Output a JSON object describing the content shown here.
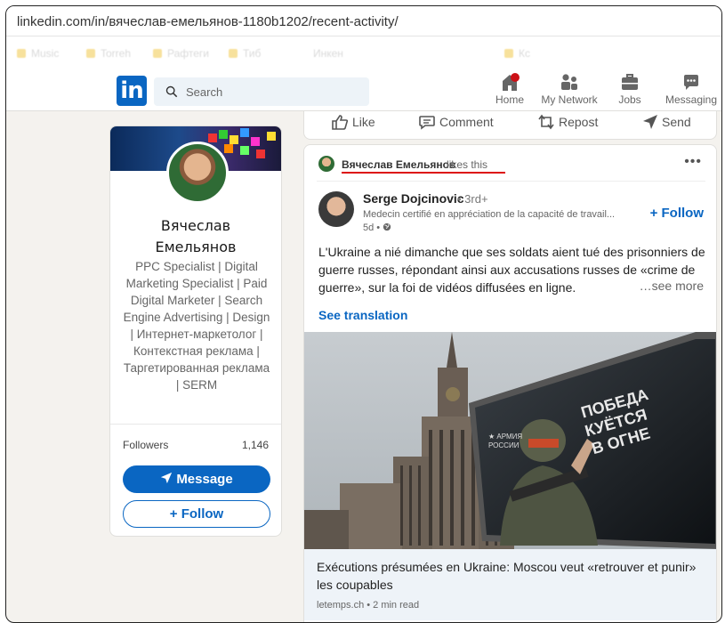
{
  "browser": {
    "url": "linkedin.com/in/вячеслав-емельянов-1180b1202/recent-activity/"
  },
  "bookmarks": [
    {
      "label": "Music"
    },
    {
      "label": "Torreh"
    },
    {
      "label": "Рафтеги"
    },
    {
      "label": "Тиб"
    },
    {
      "label": "Инкен"
    },
    {
      "label": "Кс"
    }
  ],
  "nav": {
    "search_placeholder": "Search",
    "items": [
      {
        "label": "Home"
      },
      {
        "label": "My Network"
      },
      {
        "label": "Jobs"
      },
      {
        "label": "Messaging"
      }
    ],
    "colors": {
      "brand": "#0a66c2",
      "notification": "#cc1016"
    }
  },
  "profile": {
    "name_line1": "Вячеслав",
    "name_line2": "Емельянов",
    "headline": "PPC Specialist | Digital Marketing Specialist | Paid Digital Marketer | Search Engine Advertising | Design | Интернет-маркетолог | Контекстная реклама | Таргетированная реклама | SERM",
    "followers_label": "Followers",
    "followers_count": "1,146",
    "message_label": "Message",
    "follow_label": "Follow"
  },
  "prev_actions": {
    "like": "Like",
    "comment": "Comment",
    "repost": "Repost",
    "send": "Send"
  },
  "post": {
    "liker_name": "Вячеслав Емельянов",
    "liker_action": "likes this",
    "author_name": "Serge Dojcinovic",
    "author_degree": "• 3rd+",
    "author_headline": "Medecin certifié en appréciation de la capacité de travail...",
    "author_time": "5d •",
    "follow_label": "Follow",
    "text": "L'Ukraine a nié dimanche que ses soldats aient tué des prisonniers de guerre russes, répondant ainsi aux accusations russes de «crime de guerre», sur la foi de vidéos diffusées en ligne.",
    "see_more": "…see more",
    "see_translation": "See translation",
    "billboard_text": [
      "ПОБЕДА",
      "КУЁТСЯ",
      "В ОГНЕ"
    ],
    "link_title": "Exécutions présumées en Ukraine: Moscou veut «retrouver et punir» les coupables",
    "link_source": "letemps.ch • 2 min read"
  }
}
